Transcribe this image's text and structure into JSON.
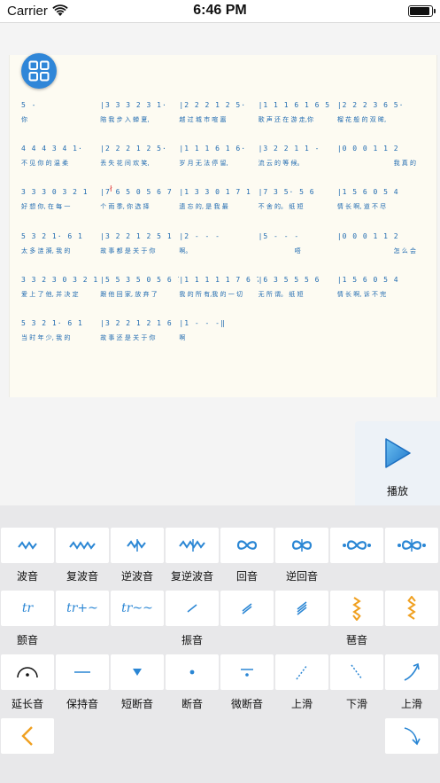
{
  "status": {
    "carrier": "Carrier",
    "time": "6:46 PM",
    "battery_level": 0.92
  },
  "score": {
    "rows": [
      {
        "notes": [
          "5   -",
          "|3 3 3 2 3 1·",
          "|2 2 2 1 2 5·",
          "|1 1 1 6 1 6 5",
          "|2 2 2 3 6 5·"
        ],
        "lyrics": [
          "你",
          "陪 我 步 入 蝉 夏,",
          "越 过 城 市 喧 嚣",
          "歌 声 还 在 游 走,你",
          "榴 花 般 的 双 眸,"
        ]
      },
      {
        "notes": [
          "4 4 4 3 4 1·",
          "|2 2 2 1 2 5·",
          "|1 1 1 6 1 6·",
          "|3 2 2 1 1 -",
          "|0 0 0 1 1 2"
        ],
        "lyrics": [
          "不 见 你 的 温 柔",
          "丢 失 花 间 欢 笑,",
          "岁 月 无 法 停 留,",
          "流 云 的 等 候。",
          "我 真 的"
        ]
      },
      {
        "notes": [
          "3 3 3 0 3 2 1",
          "|7 6 5 0 5 6 7",
          "|1 3 3 0 1 7 1",
          "|7 3 5· 5 6",
          "|1 5 6 0 5 4"
        ],
        "lyrics": [
          "好 想 你, 在 每 一",
          "个 雨 季, 你 选 择",
          "遗 忘 的, 是 我 最",
          "不 舍 的。 纸 短",
          "情 长 啊, 道 不 尽"
        ]
      },
      {
        "notes": [
          "5 3 2 1· 6 1",
          "|3 2 2 1 2 5 1",
          "|2   -   -   -",
          "|5   -   -   -",
          "|0 0 0 1 1 2"
        ],
        "lyrics": [
          "太 多 涟 漪, 我 的",
          "故 事 都 是 关 于 你",
          "啊。",
          "唔",
          "怎 么 会"
        ]
      },
      {
        "notes": [
          "3 3 2 3 0 3 2 1",
          "|5 5 3 5 0 5 6 7",
          "|1 1 1 1 1 7 6 7",
          "|6 3 5 5 5 6",
          "|1 5 6 0 5 4"
        ],
        "lyrics": [
          "爱 上 了 他, 并 决 定",
          "跟 他 回 家, 放 弃 了",
          "我 的 所 有,我 的 一 切",
          "无 所 谓。 纸 短",
          "情 长 啊, 诉 不 完"
        ]
      },
      {
        "notes": [
          "5 3 2 1· 6 1",
          "|3 2 2 1 2 1 6",
          "|1   -   -   -‖",
          "",
          ""
        ],
        "lyrics": [
          "当 时 年 少, 我 的",
          "故 事 还 是 关 于 你",
          "啊",
          "",
          ""
        ]
      }
    ]
  },
  "play": {
    "label": "播放",
    "icon": "play-icon"
  },
  "palette": {
    "row1": [
      {
        "label": "波音",
        "icon": "mordent-icon"
      },
      {
        "label": "复波音",
        "icon": "double-mordent-icon"
      },
      {
        "label": "逆波音",
        "icon": "inverted-mordent-icon"
      },
      {
        "label": "复逆波音",
        "icon": "double-inverted-mordent-icon"
      },
      {
        "label": "回音",
        "icon": "turn-icon"
      },
      {
        "label": "逆回音",
        "icon": "inverted-turn-icon"
      },
      {
        "label": "",
        "icon": "turn-variant-icon"
      },
      {
        "label": "",
        "icon": "inverted-turn-variant-icon"
      }
    ],
    "row2_labels": {
      "trill": "颤音",
      "vibrato": "振音",
      "tremolo": "琶音"
    },
    "row2_symbols": [
      "tr",
      "tr+~",
      "tr~~"
    ],
    "row3": [
      {
        "label": "延长音",
        "icon": "fermata-icon"
      },
      {
        "label": "保持音",
        "icon": "tenuto-icon"
      },
      {
        "label": "短断音",
        "icon": "staccatissimo-icon"
      },
      {
        "label": "断音",
        "icon": "staccato-icon"
      },
      {
        "label": "微断音",
        "icon": "mezzo-staccato-icon"
      },
      {
        "label": "上滑",
        "icon": "glide-up-icon"
      },
      {
        "label": "下滑",
        "icon": "glide-down-icon"
      },
      {
        "label": "上滑",
        "icon": "slide-up-icon"
      }
    ]
  },
  "colors": {
    "accent": "#2a86d4",
    "palette_bg": "#e8e8ea",
    "orange": "#f0a020"
  }
}
